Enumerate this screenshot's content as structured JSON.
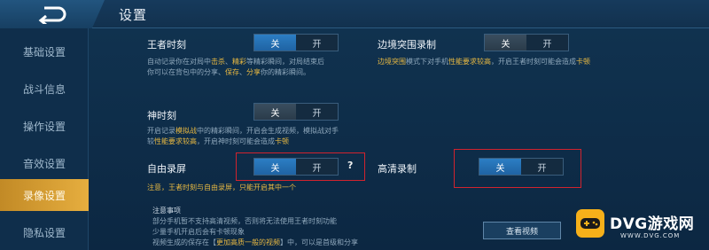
{
  "header": {
    "title": "设置",
    "back_icon": "back-arrow-icon"
  },
  "sidebar": {
    "items": [
      {
        "label": "基础设置",
        "active": false
      },
      {
        "label": "战斗信息",
        "active": false
      },
      {
        "label": "操作设置",
        "active": false
      },
      {
        "label": "音效设置",
        "active": false
      },
      {
        "label": "录像设置",
        "active": true
      },
      {
        "label": "隐私设置",
        "active": false
      }
    ]
  },
  "settings": {
    "king_moment": {
      "label": "王者时刻",
      "desc_line1_pre": "自动记录你在对局中",
      "desc_line1_hl1": "击杀",
      "desc_line1_mid": "、",
      "desc_line1_hl2": "精彩",
      "desc_line1_post": "等精彩瞬间，对局结束后",
      "desc_line2_pre": "你可以在背包中的分享、",
      "desc_line2_hl1": "保存",
      "desc_line2_mid": "、",
      "desc_line2_hl2": "分享",
      "desc_line2_post": "你的精彩瞬间。",
      "off": "关",
      "on": "开",
      "value": "关"
    },
    "edge_record": {
      "label": "边境突围录制",
      "desc_pre": "边境突围",
      "desc_mid": "模式下对手机",
      "desc_hl": "性能要求较高",
      "desc_post": "，开启王者时刻可能会造成",
      "desc_end": "卡顿",
      "off": "关",
      "on": "开",
      "value": "关"
    },
    "god_moment": {
      "label": "神时刻",
      "desc_line1_pre": "开启记录",
      "desc_line1_hl": "模拟战",
      "desc_line1_post": "中的精彩瞬间，开启会生成视频，模拟战对手",
      "desc_line2_pre": "较",
      "desc_line2_hl": "性能要求较高",
      "desc_line2_post": "，开启神时刻可能会造成",
      "desc_line2_end": "卡顿",
      "off": "关",
      "on": "开",
      "value": "关"
    },
    "free_record": {
      "label": "自由录屏",
      "help": "?",
      "desc_hl": "注意",
      "desc_post": "，王者时刻与自由录屏，只能开启其中一个",
      "off": "关",
      "on": "开",
      "value": "关"
    },
    "hd_record": {
      "label": "高清录制",
      "off": "关",
      "on": "开",
      "value": "关"
    },
    "notes": {
      "title": "注意事项",
      "line1": "部分手机暂不支持高清视频，否则将无法使用王者时刻功能",
      "line2": "少量手机开启后会有卡顿现象",
      "line3_pre": "视频生成的保存在【",
      "line3_hl": "更加高质一般的视频",
      "line3_post": "】中，可以是首级和分享"
    },
    "view_button": "查看视频"
  },
  "watermark": {
    "brand": "DVG游戏网",
    "url": "WWW.DVG.COM"
  },
  "colors": {
    "accent": "#2c7ec4",
    "highlight": "#e7b842",
    "active_tab": "#e6ae3f",
    "red_box": "#d1232e"
  }
}
